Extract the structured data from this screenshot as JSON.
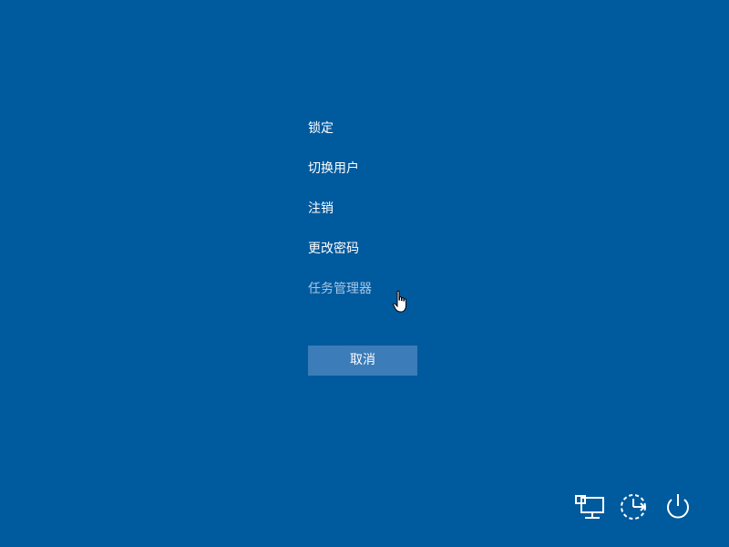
{
  "menu": {
    "items": [
      {
        "id": "lock",
        "label": "锁定"
      },
      {
        "id": "switch-user",
        "label": "切换用户"
      },
      {
        "id": "sign-out",
        "label": "注销"
      },
      {
        "id": "change-password",
        "label": "更改密码"
      },
      {
        "id": "task-manager",
        "label": "任务管理器"
      }
    ]
  },
  "cancel_label": "取消",
  "tray": {
    "icons": [
      "network-icon",
      "ease-of-access-icon",
      "power-icon"
    ]
  },
  "colors": {
    "background": "#005a9e",
    "button": "#3c7cb8",
    "hover_text": "#a9c6e4"
  }
}
